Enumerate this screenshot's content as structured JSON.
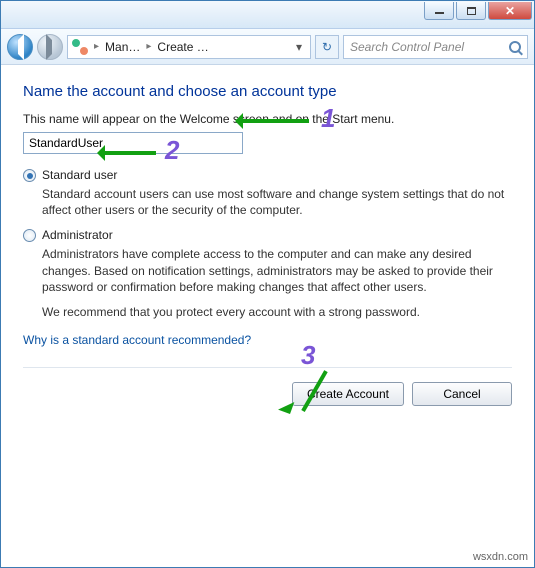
{
  "window": {
    "address": {
      "crumb1": "Man…",
      "crumb2": "Create …"
    },
    "search_placeholder": "Search Control Panel"
  },
  "page": {
    "heading": "Name the account and choose an account type",
    "intro": "This name will appear on the Welcome screen and on the Start menu.",
    "name_value": "StandardUser",
    "options": {
      "standard": {
        "label": "Standard user",
        "desc": "Standard account users can use most software and change system settings that do not affect other users or the security of the computer."
      },
      "admin": {
        "label": "Administrator",
        "desc": "Administrators have complete access to the computer and can make any desired changes. Based on notification settings, administrators may be asked to provide their password or confirmation before making changes that affect other users."
      }
    },
    "recommend": "We recommend that you protect every account with a strong password.",
    "link": "Why is a standard account recommended?",
    "buttons": {
      "create": "Create Account",
      "cancel": "Cancel"
    }
  },
  "annotations": {
    "n1": "1",
    "n2": "2",
    "n3": "3"
  },
  "watermark": "wsxdn.com"
}
